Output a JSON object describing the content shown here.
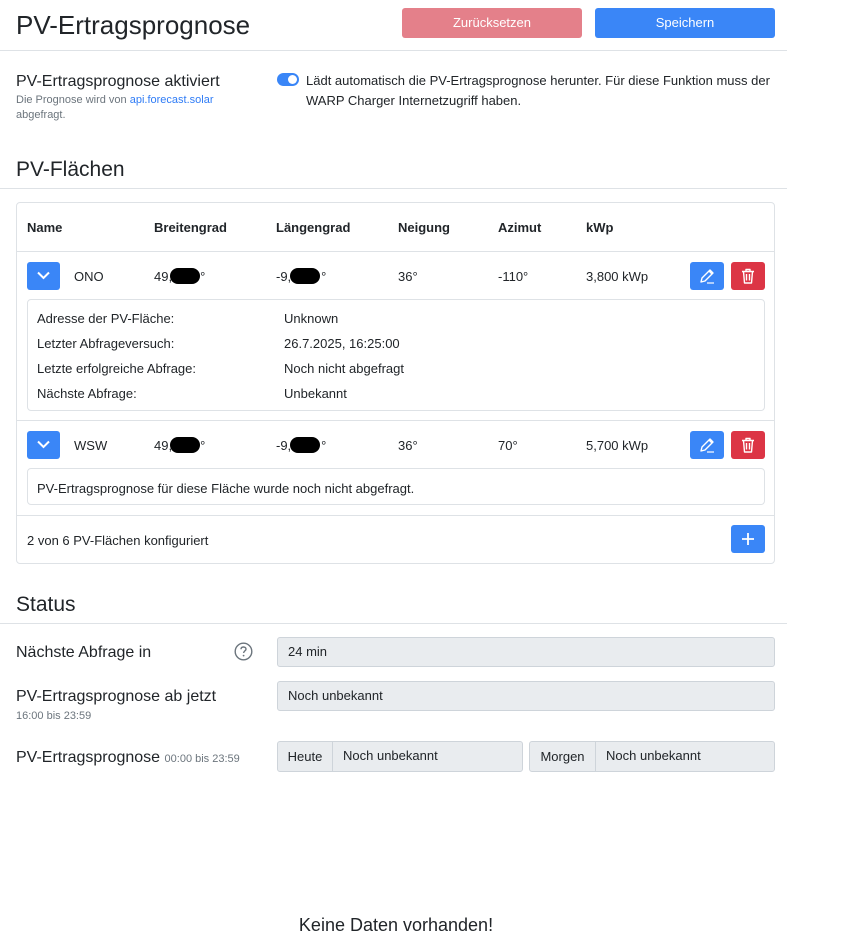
{
  "header": {
    "title": "PV-Ertragsprognose",
    "reset_label": "Zurücksetzen",
    "save_label": "Speichern"
  },
  "activation": {
    "label": "PV-Ertragsprognose aktiviert",
    "hint_prefix": "Die Prognose wird von ",
    "hint_link": "api.forecast.solar",
    "hint_suffix": "abgefragt.",
    "enabled": true,
    "description": "Lädt automatisch die PV-Ertragsprognose herunter. Für diese Funktion muss der WARP Charger Internetzugriff haben."
  },
  "pv_section": {
    "title": "PV-Flächen",
    "columns": [
      "Name",
      "Breitengrad",
      "Längengrad",
      "Neigung",
      "Azimut",
      "kWp"
    ],
    "rows": [
      {
        "name": "ONO",
        "lat": "49,",
        "lat_tail": "°",
        "lon": "-9,",
        "lon_tail": "°",
        "tilt": "36°",
        "azimuth": "-110°",
        "kwp": "3,800 kWp",
        "details": [
          {
            "label": "Adresse der PV-Fläche:",
            "value": "Unknown"
          },
          {
            "label": "Letzter Abfrageversuch:",
            "value": "26.7.2025, 16:25:00"
          },
          {
            "label": "Letzte erfolgreiche Abfrage:",
            "value": "Noch nicht abgefragt"
          },
          {
            "label": "Nächste Abfrage:",
            "value": "Unbekannt"
          }
        ]
      },
      {
        "name": "WSW",
        "lat": "49,",
        "lat_tail": "°",
        "lon": "-9,",
        "lon_tail": "°",
        "tilt": "36°",
        "azimuth": "70°",
        "kwp": "5,700 kWp",
        "note": "PV-Ertragsprognose für diese Fläche wurde noch nicht abgefragt."
      }
    ],
    "footer": "2 von 6 PV-Flächen konfiguriert"
  },
  "status": {
    "title": "Status",
    "next_query_label": "Nächste Abfrage in",
    "next_query_value": "24 min",
    "from_now_label": "PV-Ertragsprognose ab jetzt",
    "from_now_sub": "16:00 bis 23:59",
    "from_now_value": "Noch unbekannt",
    "forecast_label": "PV-Ertragsprognose",
    "forecast_sub": "00:00 bis 23:59",
    "today_label": "Heute",
    "today_value": "Noch unbekannt",
    "tomorrow_label": "Morgen",
    "tomorrow_value": "Noch unbekannt"
  },
  "chart": {
    "empty_text": "Keine Daten vorhanden!"
  },
  "colors": {
    "primary": "#3a86f7",
    "danger": "#dc3545",
    "reset": "#e4808a"
  }
}
